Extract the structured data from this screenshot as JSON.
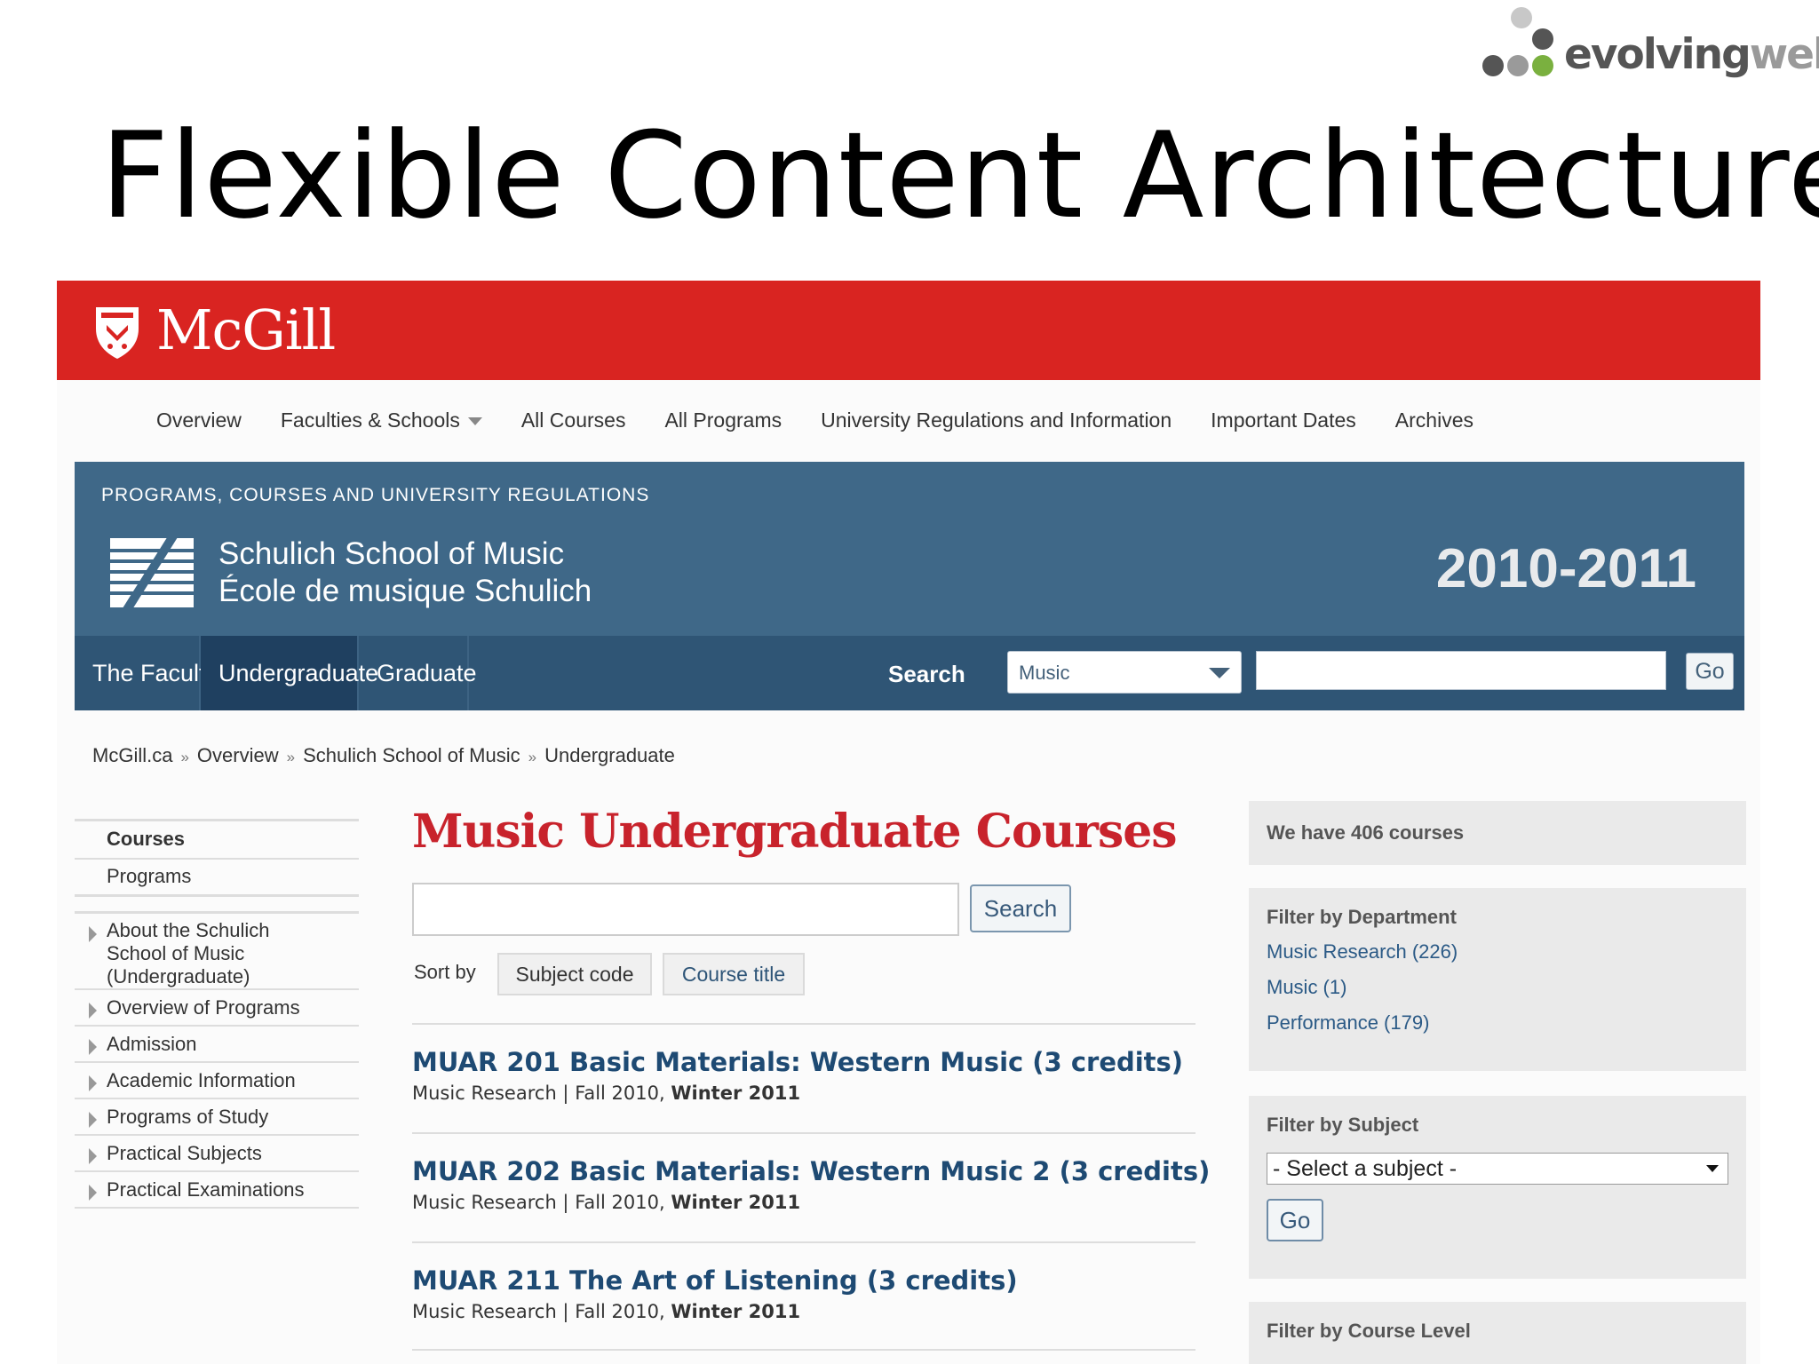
{
  "slide": {
    "logo": {
      "part1": "evolving",
      "part2": "web"
    },
    "title": "Flexible Content Architecture"
  },
  "colors": {
    "mcgill_red": "#d92421",
    "banner_blue": "#3f6888",
    "subnav_blue": "#2f5575",
    "course_title": "#1e4a73",
    "page_title_red": "#c8232c"
  },
  "header": {
    "brand": "McGill",
    "crest_icon": "mcgill-crest-icon"
  },
  "topnav": {
    "items": [
      {
        "label": "Overview"
      },
      {
        "label": "Faculties & Schools",
        "has_caret": true
      },
      {
        "label": "All Courses"
      },
      {
        "label": "All Programs"
      },
      {
        "label": "University Regulations and Information"
      },
      {
        "label": "Important Dates"
      },
      {
        "label": "Archives"
      }
    ]
  },
  "banner": {
    "label": "PROGRAMS, COURSES AND UNIVERSITY REGULATIONS",
    "school_en": "Schulich School of Music",
    "school_fr": "École de musique Schulich",
    "year": "2010-2011"
  },
  "subnav": {
    "tabs": [
      {
        "label": "The Faculty"
      },
      {
        "label": "Undergraduate",
        "active": true
      },
      {
        "label": "Graduate"
      }
    ],
    "search_label": "Search",
    "select_value": "Music",
    "go_label": "Go"
  },
  "breadcrumb": [
    "McGill.ca",
    "Overview",
    "Schulich School of Music",
    "Undergraduate"
  ],
  "sidebar": {
    "top_items": [
      {
        "label": "Courses",
        "bold": true
      },
      {
        "label": "Programs"
      }
    ],
    "items": [
      {
        "label_lines": [
          "About the Schulich",
          "School of Music",
          "(Undergraduate)"
        ]
      },
      {
        "label_lines": [
          "Overview of Programs"
        ]
      },
      {
        "label_lines": [
          "Admission"
        ]
      },
      {
        "label_lines": [
          "Academic Information"
        ]
      },
      {
        "label_lines": [
          "Programs of Study"
        ]
      },
      {
        "label_lines": [
          "Practical Subjects"
        ]
      },
      {
        "label_lines": [
          "Practical Examinations"
        ]
      }
    ]
  },
  "main": {
    "title": "Music Undergraduate Courses",
    "search_button": "Search",
    "sort_label": "Sort by",
    "sort_options": [
      "Subject code",
      "Course title"
    ],
    "courses": [
      {
        "title": "MUAR 201 Basic Materials: Western Music (3 credits)",
        "dept": "Music Research",
        "term1": "Fall 2010,",
        "term2": "Winter 2011"
      },
      {
        "title": "MUAR 202 Basic Materials: Western Music 2 (3 credits)",
        "dept": "Music Research",
        "term1": "Fall 2010,",
        "term2": "Winter 2011"
      },
      {
        "title": "MUAR 211 The Art of Listening (3 credits)",
        "dept": "Music Research",
        "term1": "Fall 2010,",
        "term2": "Winter 2011"
      }
    ]
  },
  "right": {
    "count_text": "We have 406 courses",
    "filter_department": {
      "heading": "Filter by Department",
      "links": [
        "Music Research (226)",
        "Music (1)",
        "Performance (179)"
      ]
    },
    "filter_subject": {
      "heading": "Filter by Subject",
      "select_value": "- Select a subject -",
      "go_label": "Go"
    },
    "filter_level": {
      "heading": "Filter by Course Level"
    }
  }
}
